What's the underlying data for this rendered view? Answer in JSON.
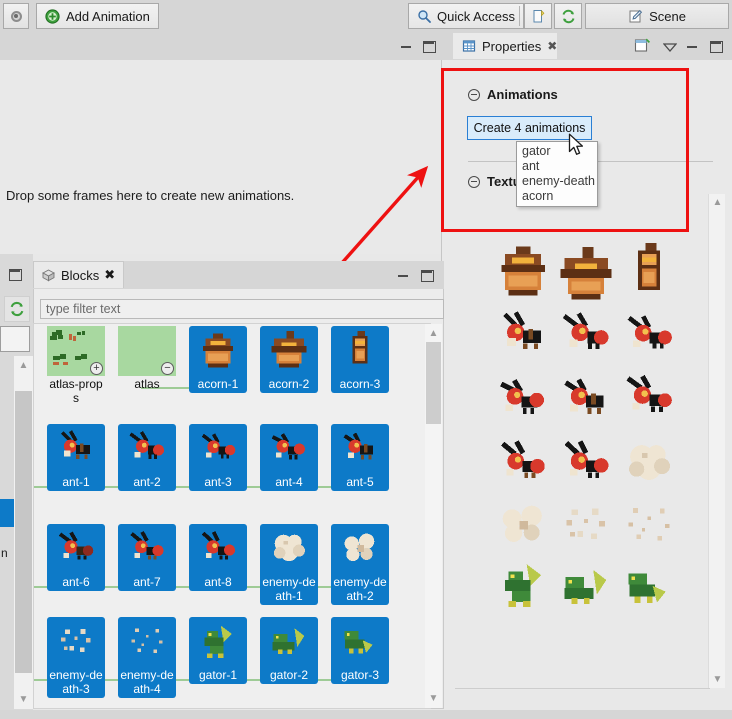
{
  "app": {
    "toolbar": {
      "perspective_icon": "perspective-dot-icon",
      "add_animation_label": "Add Animation",
      "add_animation_icon": "add-green-plus-icon",
      "quick_access_label": "Quick Access",
      "quick_access_icon": "search-icon",
      "new_icon": "new-file-icon",
      "refresh_icon": "refresh-sync-icon",
      "scene_label": "Scene",
      "scene_icon": "scene-pencil-icon"
    }
  },
  "editor": {
    "drop_hint": "Drop some frames here to create new animations.",
    "minimize_icon": "minimize-icon",
    "maximize_icon": "maximize-icon"
  },
  "properties": {
    "tab_label": "Properties",
    "tab_icon": "properties-table-icon",
    "close_icon": "close-icon",
    "toolbar": {
      "new_icon": "new-view-icon",
      "menu_icon": "view-menu-chevron-down-icon",
      "minimize_icon": "minimize-icon",
      "maximize_icon": "maximize-icon"
    },
    "sections": [
      {
        "title": "Animations",
        "collapse_icon": "collapse-minus-icon"
      },
      {
        "title": "Textures",
        "collapse_icon": "collapse-minus-icon"
      }
    ],
    "create_button_label": "Create 4 animations",
    "dropdown_options": [
      "gator",
      "ant",
      "enemy-death",
      "acorn"
    ],
    "cursor_icon": "mouse-pointer-icon",
    "scrollbar": {
      "up_icon": "scroll-up-chevron-icon",
      "down_icon": "scroll-down-chevron-icon"
    },
    "texture_sprites": [
      "acorn-1",
      "acorn-2",
      "acorn-3",
      "ant-1",
      "ant-2",
      "ant-3",
      "ant-4",
      "ant-5",
      "ant-6",
      "ant-7",
      "ant-8",
      "enemy-death-1",
      "enemy-death-2",
      "enemy-death-3",
      "enemy-death-4",
      "gator-1",
      "gator-2",
      "gator-3"
    ]
  },
  "annotation": {
    "box_color": "#ee1111",
    "arrow_color": "#ee1111",
    "arrow_name": "red-callout-arrow"
  },
  "blocks": {
    "tab_label": "Blocks",
    "tab_icon": "blocks-cube-icon",
    "close_icon": "close-icon",
    "minimize_icon": "minimize-icon",
    "maximize_icon": "maximize-icon",
    "filter_placeholder": "type filter text",
    "filter_value": "",
    "items": [
      {
        "label": "atlas-props",
        "kind": "folder",
        "badge": "+"
      },
      {
        "label": "atlas",
        "kind": "folder",
        "badge": "−"
      },
      {
        "label": "acorn-1",
        "kind": "sprite"
      },
      {
        "label": "acorn-2",
        "kind": "sprite"
      },
      {
        "label": "acorn-3",
        "kind": "sprite"
      },
      {
        "label": "ant-1",
        "kind": "sprite"
      },
      {
        "label": "ant-2",
        "kind": "sprite"
      },
      {
        "label": "ant-3",
        "kind": "sprite"
      },
      {
        "label": "ant-4",
        "kind": "sprite"
      },
      {
        "label": "ant-5",
        "kind": "sprite"
      },
      {
        "label": "ant-6",
        "kind": "sprite"
      },
      {
        "label": "ant-7",
        "kind": "sprite"
      },
      {
        "label": "ant-8",
        "kind": "sprite"
      },
      {
        "label": "enemy-death-1",
        "kind": "sprite"
      },
      {
        "label": "enemy-death-2",
        "kind": "sprite"
      },
      {
        "label": "enemy-death-3",
        "kind": "sprite"
      },
      {
        "label": "enemy-death-4",
        "kind": "sprite"
      },
      {
        "label": "gator-1",
        "kind": "sprite"
      },
      {
        "label": "gator-2",
        "kind": "sprite"
      },
      {
        "label": "gator-3",
        "kind": "sprite"
      }
    ],
    "scrollbar": {
      "up_icon": "scroll-up-chevron-icon",
      "down_icon": "scroll-down-chevron-icon"
    }
  },
  "left_strip": {
    "maximize_icon": "maximize-icon",
    "refresh_icon": "refresh-sync-icon",
    "truncated_label": "n",
    "scrollbar": {
      "up_icon": "scroll-up-chevron-icon",
      "down_icon": "scroll-down-chevron-icon"
    }
  },
  "colors": {
    "selection_blue": "#0d7ac8",
    "button_border_blue": "#2a7fd4",
    "annotation_red": "#ee1111",
    "folder_green": "#a8d8a0",
    "panel_bg": "#e9e9e9",
    "chrome_bg": "#d6d6d6"
  }
}
